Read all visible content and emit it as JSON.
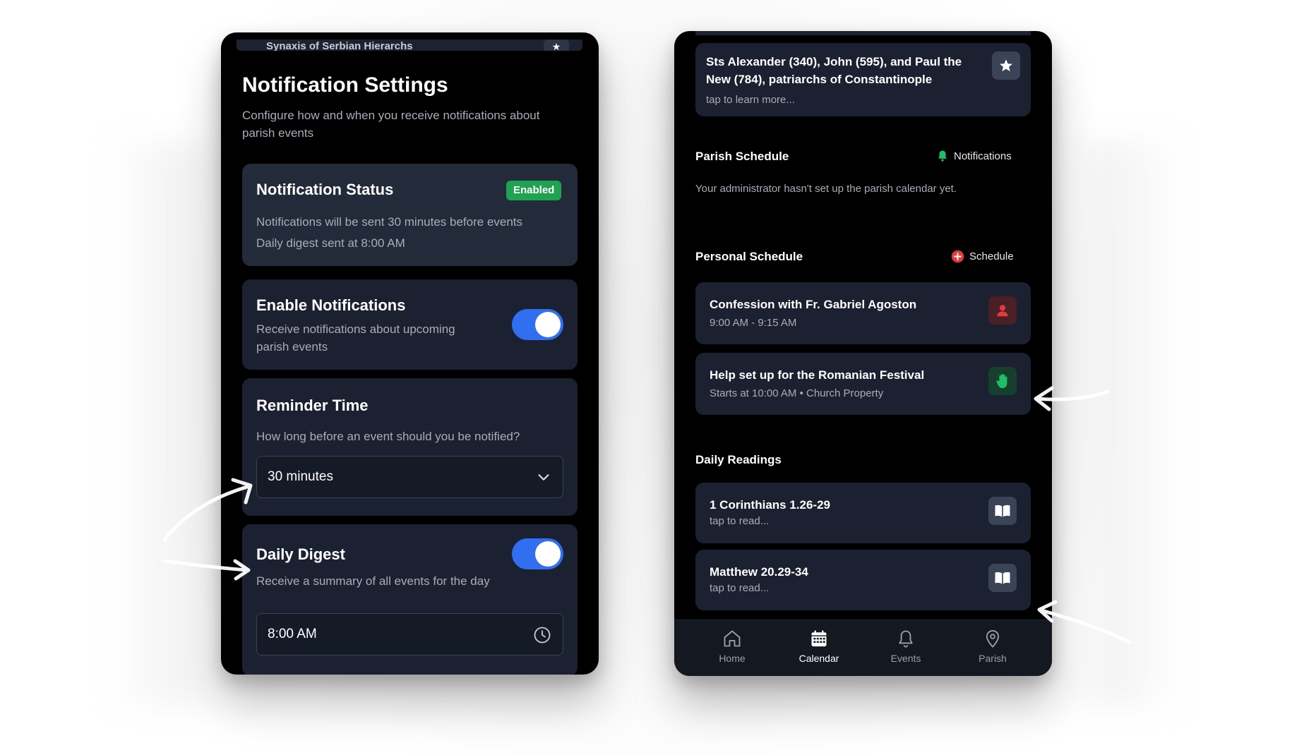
{
  "left_phone": {
    "peek": {
      "title": "Synaxis of Serbian Hierarchs"
    },
    "header": {
      "title": "Notification Settings",
      "subtitle": "Configure how and when you receive notifications about parish events"
    },
    "status_card": {
      "title": "Notification Status",
      "badge": "Enabled",
      "line1": "Notifications will be sent 30 minutes before events",
      "line2": "Daily digest sent at 8:00 AM"
    },
    "enable_card": {
      "title": "Enable Notifications",
      "description": "Receive notifications about upcoming parish events",
      "toggle_on": true
    },
    "reminder_card": {
      "title": "Reminder Time",
      "question": "How long before an event should you be notified?",
      "selected": "30 minutes"
    },
    "digest_card": {
      "title": "Daily Digest",
      "description": "Receive a summary of all events for the day",
      "toggle_on": true,
      "time": "8:00 AM"
    }
  },
  "right_phone": {
    "saint_card": {
      "title": "Sts Alexander (340), John (595), and Paul the New (784), patriarchs of Constantinople",
      "subtitle": "tap to learn more..."
    },
    "parish_schedule": {
      "title": "Parish Schedule",
      "action": "Notifications",
      "empty": "Your administrator hasn't set up the parish calendar yet."
    },
    "personal_schedule": {
      "title": "Personal Schedule",
      "action": "Schedule",
      "items": [
        {
          "title": "Confession with Fr. Gabriel Agoston",
          "subtitle": "9:00 AM - 9:15 AM",
          "icon": "person-icon",
          "color": "#e23b3b"
        },
        {
          "title": "Help set up for the Romanian Festival",
          "subtitle": "Starts at 10:00 AM • Church Property",
          "icon": "hand-icon",
          "color": "#1fbf6a"
        }
      ]
    },
    "daily_readings": {
      "title": "Daily Readings",
      "items": [
        {
          "title": "1 Corinthians 1.26-29",
          "subtitle": "tap to read..."
        },
        {
          "title": "Matthew 20.29-34",
          "subtitle": "tap to read..."
        }
      ]
    },
    "tabbar": {
      "tabs": [
        {
          "label": "Home",
          "icon": "home-icon"
        },
        {
          "label": "Calendar",
          "icon": "calendar-icon",
          "active": true
        },
        {
          "label": "Events",
          "icon": "bell-icon"
        },
        {
          "label": "Parish",
          "icon": "map-pin-icon"
        }
      ]
    }
  },
  "colors": {
    "accent_blue": "#2f6ff0",
    "enabled_green": "#1fa352",
    "card_bg": "#1b2130",
    "bell_green": "#1fbf6a",
    "schedule_red": "#e23b3b"
  }
}
